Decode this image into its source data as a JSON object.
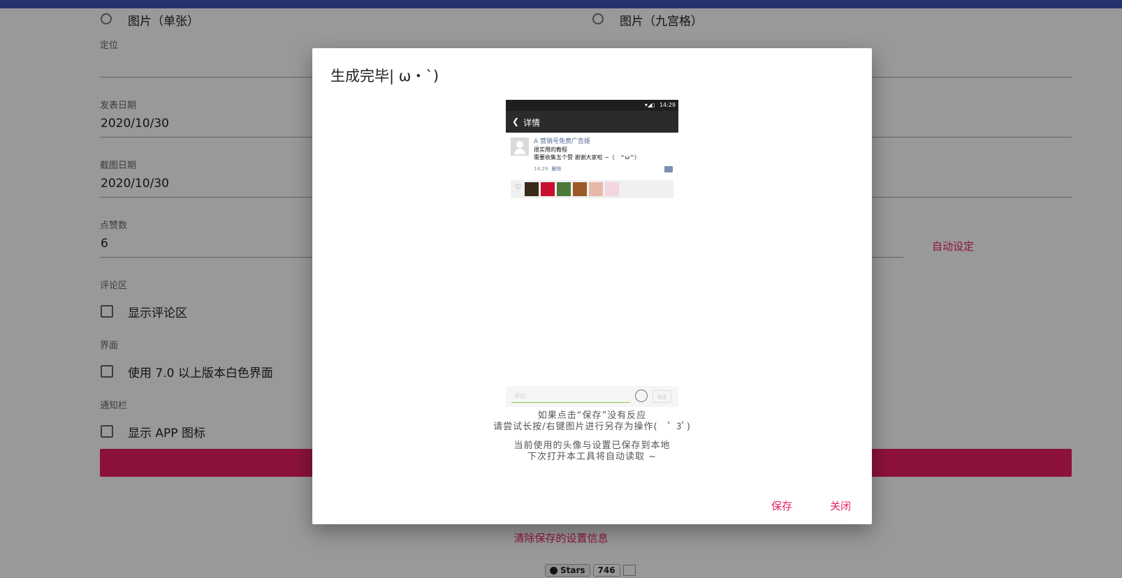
{
  "form": {
    "radio_single": "图片（单张）",
    "radio_grid": "图片（九宫格）",
    "location_label": "定位",
    "location_value": "",
    "publish_label": "发表日期",
    "publish_value": "2020/10/30",
    "screenshot_label": "截图日期",
    "screenshot_value": "2020/10/30",
    "likes_label": "点赞数",
    "likes_value": "6",
    "auto_set": "自动设定",
    "comments_label": "评论区",
    "comments_checkbox": "显示评论区",
    "ui_label": "界面",
    "ui_checkbox": "使用 7.0 以上版本白色界面",
    "notify_label": "通知栏",
    "notify_checkbox": "显示 APP 图标",
    "clear_link": "清除保存的设置信息"
  },
  "github": {
    "stars_label": "Stars",
    "stars_count": "746"
  },
  "dialog": {
    "title": "生成完毕| ω・`)",
    "notice_1a": "如果点击“保存”没有反应",
    "notice_1b": "请尝试长按/右键图片进行另存为操作(　ﾟ 3ﾟ)",
    "notice_2a": "当前使用的头像与设置已保存到本地",
    "notice_2b": "下次打开本工具将自动读取 ~",
    "save": "保存",
    "close": "关闭"
  },
  "preview": {
    "time": "14:29",
    "nav_title": "详情",
    "name": "A 营销号免费广告姬",
    "text": "很实用的教程\n需要收集五个赞 谢谢大家啦 ~（　^ω^）",
    "meta_time": "14:29",
    "meta_delete": "删除",
    "comment_placeholder": "评论",
    "send": "发送",
    "like_colors": [
      "#3a2a1a",
      "#c8102e",
      "#4d7a3a",
      "#9c5a2a",
      "#e6b8a8",
      "#f3d6df"
    ]
  }
}
